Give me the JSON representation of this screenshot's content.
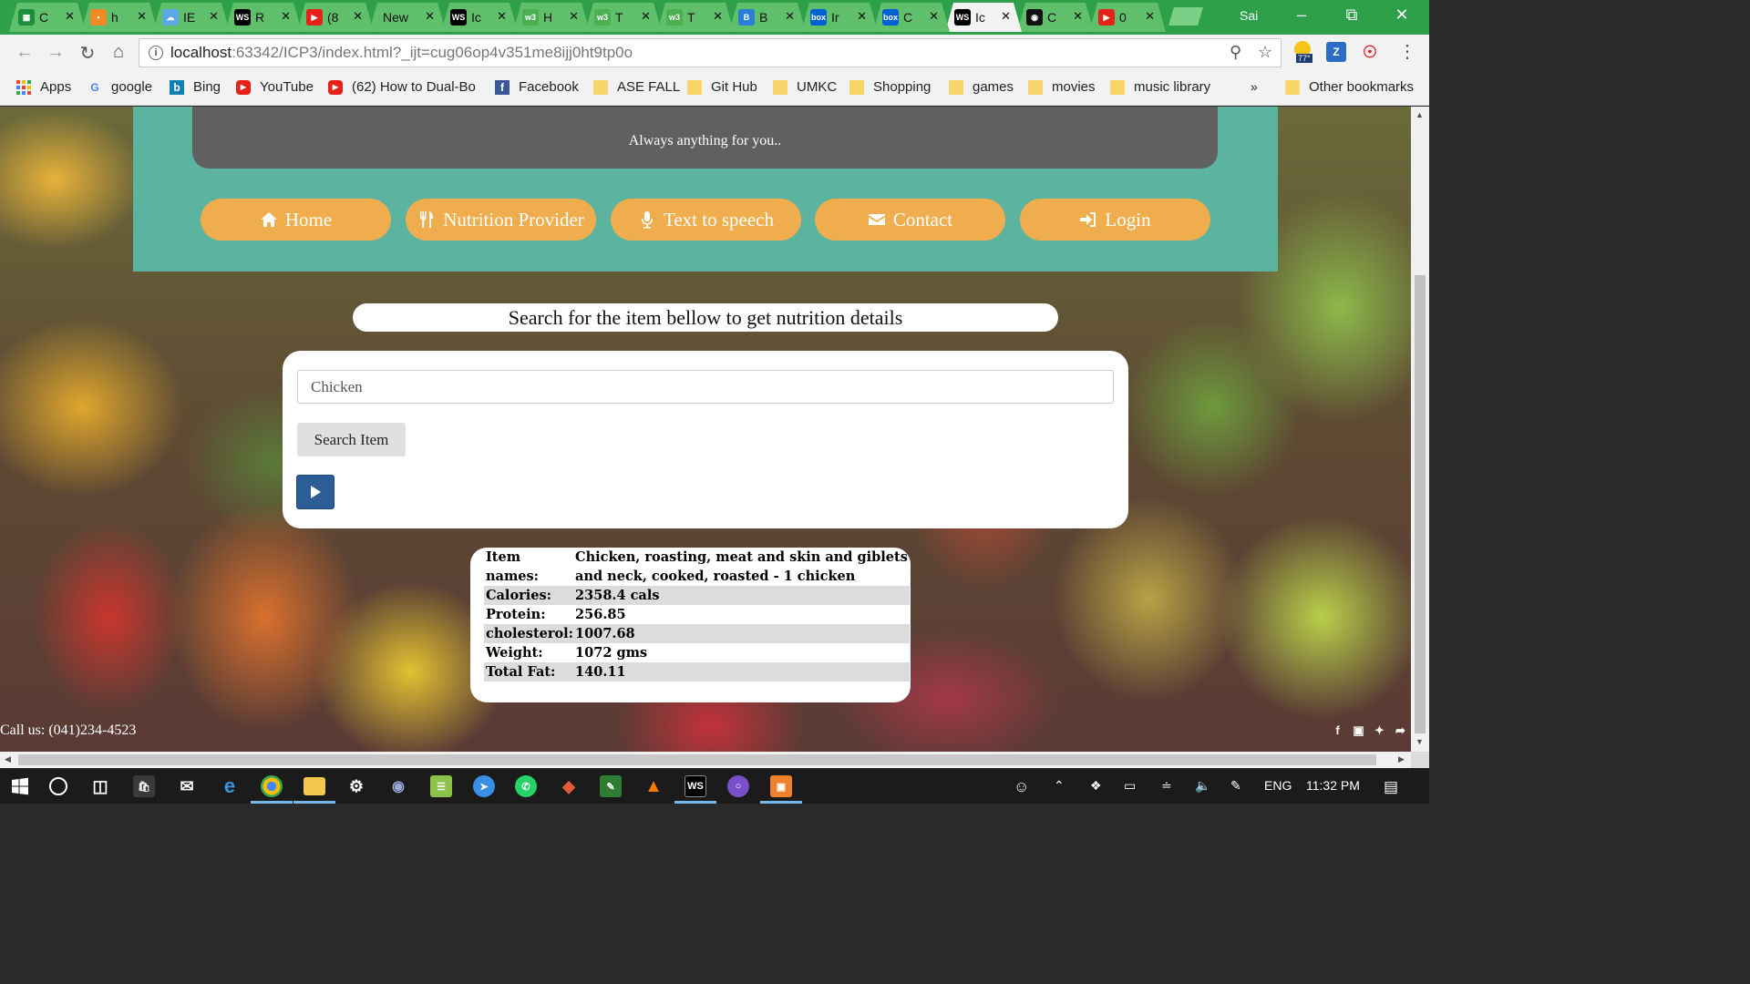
{
  "browser": {
    "tabs": [
      {
        "title": "C",
        "icon": "sheets-icon",
        "color": "#1e8e3e",
        "glyph": "▦",
        "active": false
      },
      {
        "title": "h",
        "icon": "dots-icon",
        "color": "#f08a24",
        "glyph": "•",
        "active": false
      },
      {
        "title": "IE",
        "icon": "cloud-icon",
        "color": "#5aa9e6",
        "glyph": "☁",
        "active": false
      },
      {
        "title": "R",
        "icon": "webstorm-icon",
        "color": "#000000",
        "glyph": "WS",
        "active": false
      },
      {
        "title": "(8",
        "icon": "youtube-icon",
        "color": "#e62117",
        "glyph": "▶",
        "active": false
      },
      {
        "title": "New",
        "icon": "",
        "color": "",
        "glyph": "",
        "active": false
      },
      {
        "title": "Ic",
        "icon": "webstorm-icon",
        "color": "#000000",
        "glyph": "WS",
        "active": false
      },
      {
        "title": "H",
        "icon": "w3schools-icon",
        "color": "#4caf50",
        "glyph": "w3",
        "active": false
      },
      {
        "title": "T",
        "icon": "w3schools-icon",
        "color": "#4caf50",
        "glyph": "w3",
        "active": false
      },
      {
        "title": "T",
        "icon": "w3schools-icon",
        "color": "#4caf50",
        "glyph": "w3",
        "active": false
      },
      {
        "title": "B",
        "icon": "bootstrap-icon",
        "color": "#2a7fd4",
        "glyph": "B",
        "active": false
      },
      {
        "title": "Ir",
        "icon": "box-icon",
        "color": "#0061d5",
        "glyph": "box",
        "active": false
      },
      {
        "title": "C",
        "icon": "box-icon",
        "color": "#0061d5",
        "glyph": "box",
        "active": false
      },
      {
        "title": "Ic",
        "icon": "webstorm-icon",
        "color": "#000000",
        "glyph": "WS",
        "active": true
      },
      {
        "title": "C",
        "icon": "github-icon",
        "color": "#111111",
        "glyph": "◉",
        "active": false
      },
      {
        "title": "0",
        "icon": "youtube-icon",
        "color": "#e62117",
        "glyph": "▶",
        "active": false
      }
    ],
    "profile_name": "Sai",
    "url_host": "localhost",
    "url_rest": ":63342/ICP3/index.html?_ijt=cug06op4v351me8ijj0ht9tp0o",
    "weather_temp": "77°",
    "bookmarks": [
      {
        "label": "Apps",
        "icon": "apps-icon"
      },
      {
        "label": "google",
        "icon": "google-icon"
      },
      {
        "label": "Bing",
        "icon": "bing-icon"
      },
      {
        "label": "YouTube",
        "icon": "youtube-icon"
      },
      {
        "label": "(62) How to Dual-Bo",
        "icon": "youtube-icon"
      },
      {
        "label": "Facebook",
        "icon": "facebook-icon"
      },
      {
        "label": "ASE FALL",
        "icon": "folder-icon"
      },
      {
        "label": "Git Hub",
        "icon": "folder-icon"
      },
      {
        "label": "UMKC",
        "icon": "folder-icon"
      },
      {
        "label": "Shopping",
        "icon": "folder-icon"
      },
      {
        "label": "games",
        "icon": "folder-icon"
      },
      {
        "label": "movies",
        "icon": "folder-icon"
      },
      {
        "label": "music library",
        "icon": "folder-icon"
      }
    ],
    "overflow_label": "»",
    "other_bookmarks": "Other bookmarks"
  },
  "page": {
    "tagline": "Always anything for you..",
    "nav": [
      {
        "label": "Home",
        "icon": "home-icon"
      },
      {
        "label": "Nutrition Provider",
        "icon": "cutlery-icon"
      },
      {
        "label": "Text to speech",
        "icon": "microphone-icon"
      },
      {
        "label": "Contact",
        "icon": "envelope-icon"
      },
      {
        "label": "Login",
        "icon": "sign-in-icon"
      }
    ],
    "search_title": "Search for the item bellow to get nutrition details",
    "search_value": "Chicken",
    "search_button": "Search Item",
    "results": [
      {
        "key": "Item names:",
        "value": "Chicken, roasting, meat and skin and giblets and neck, cooked, roasted - 1 chicken"
      },
      {
        "key": "Calories:",
        "value": "2358.4 cals"
      },
      {
        "key": "Protein:",
        "value": "256.85"
      },
      {
        "key": "cholesterol:",
        "value": "1007.68"
      },
      {
        "key": "Weight:",
        "value": "1072 gms"
      },
      {
        "key": "Total Fat:",
        "value": "140.11"
      }
    ],
    "footer_call": "Call us: (041)234-4523",
    "colors": {
      "header": "#5cb3a0",
      "nav_button": "#f0ad4e",
      "tagline_box": "#606060",
      "play_button": "#2d5d96"
    }
  },
  "taskbar": {
    "language": "ENG",
    "time": "11:32 PM"
  }
}
